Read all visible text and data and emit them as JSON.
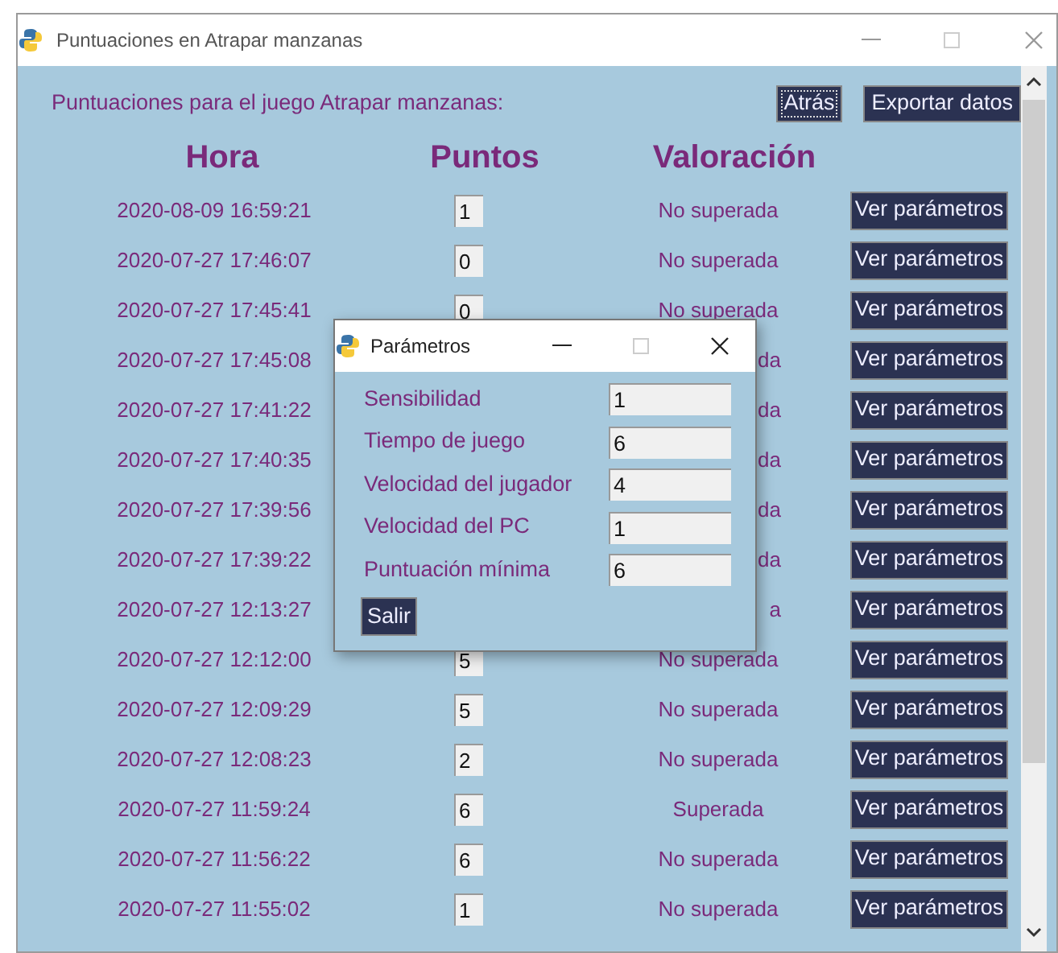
{
  "window": {
    "title": "Puntuaciones en Atrapar manzanas"
  },
  "heading": "Puntuaciones para el juego Atrapar manzanas:",
  "buttons": [
    {
      "label": "Atrás",
      "focused": true
    },
    {
      "label": "Exportar datos",
      "focused": false
    }
  ],
  "columns": [
    "Hora",
    "Puntos",
    "Valoración"
  ],
  "rows": [
    {
      "time": "2020-08-09 16:59:21",
      "points": "1",
      "rating": "No superada",
      "covered": false,
      "button": "Ver parámetros"
    },
    {
      "time": "2020-07-27 17:46:07",
      "points": "0",
      "rating": "No superada",
      "covered": false,
      "button": "Ver parámetros"
    },
    {
      "time": "2020-07-27 17:45:41",
      "points": "0",
      "rating": "No superada",
      "covered": false,
      "button": "Ver parámetros"
    },
    {
      "time": "2020-07-27 17:45:08",
      "rating": "da",
      "covered": true,
      "button": "Ver parámetros"
    },
    {
      "time": "2020-07-27 17:41:22",
      "rating": "da",
      "covered": true,
      "button": "Ver parámetros"
    },
    {
      "time": "2020-07-27 17:40:35",
      "rating": "da",
      "covered": true,
      "button": "Ver parámetros"
    },
    {
      "time": "2020-07-27 17:39:56",
      "rating": "da",
      "covered": true,
      "button": "Ver parámetros"
    },
    {
      "time": "2020-07-27 17:39:22",
      "rating": "da",
      "covered": true,
      "button": "Ver parámetros"
    },
    {
      "time": "2020-07-27 12:13:27",
      "rating": "a",
      "covered": true,
      "button": "Ver parámetros"
    },
    {
      "time": "2020-07-27 12:12:00",
      "points": "5",
      "rating": "No superada",
      "covered": false,
      "button": "Ver parámetros"
    },
    {
      "time": "2020-07-27 12:09:29",
      "points": "5",
      "rating": "No superada",
      "covered": false,
      "button": "Ver parámetros"
    },
    {
      "time": "2020-07-27 12:08:23",
      "points": "2",
      "rating": "No superada",
      "covered": false,
      "button": "Ver parámetros"
    },
    {
      "time": "2020-07-27 11:59:24",
      "points": "6",
      "rating": "Superada",
      "covered": false,
      "button": "Ver parámetros"
    },
    {
      "time": "2020-07-27 11:56:22",
      "points": "6",
      "rating": "No superada",
      "covered": false,
      "button": "Ver parámetros"
    },
    {
      "time": "2020-07-27 11:55:02",
      "points": "1",
      "rating": "No superada",
      "covered": false,
      "button": "Ver parámetros"
    }
  ],
  "dialog": {
    "title": "Parámetros",
    "fields": [
      {
        "label": "Sensibilidad",
        "value": "1"
      },
      {
        "label": "Tiempo de juego",
        "value": "6"
      },
      {
        "label": "Velocidad del jugador",
        "value": "4"
      },
      {
        "label": "Velocidad del PC",
        "value": "1"
      },
      {
        "label": "Puntuación mínima",
        "value": "6"
      }
    ],
    "button": "Salir"
  }
}
